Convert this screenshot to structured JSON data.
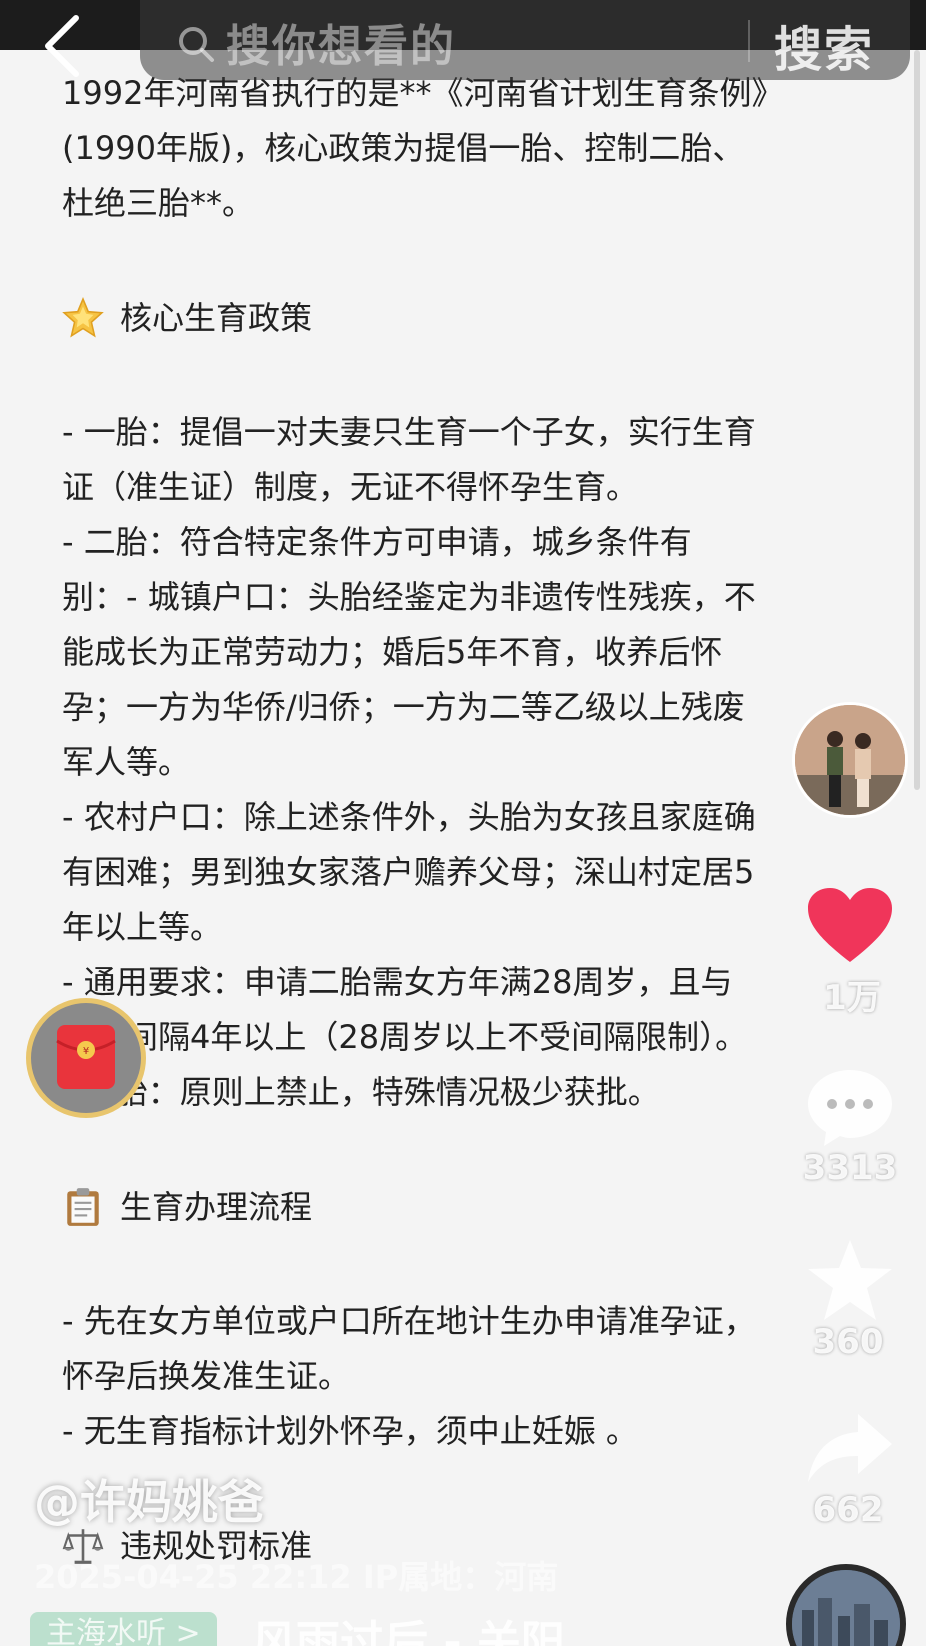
{
  "search": {
    "placeholder": "搜你想看的",
    "button": "搜索"
  },
  "document": {
    "intro": [
      "1992年河南省执行的是**《河南省计划生育条例》",
      "(1990年版)，核心政策为提倡一胎、控制二胎、",
      "杜绝三胎**。"
    ],
    "section1_title": "核心生育政策",
    "section1_lines": [
      "- 一胎：提倡一对夫妻只生育一个子女，实行生育",
      "证（准生证）制度，无证不得怀孕生育。",
      "- 二胎：符合特定条件方可申请，城乡条件有",
      "别：- 城镇户口：头胎经鉴定为非遗传性残疾，不",
      "能成长为正常劳动力；婚后5年不育，收养后怀",
      "孕；一方为华侨/归侨；一方为二等乙级以上残废",
      "军人等。",
      "- 农村户口：除上述条件外，头胎为女孩且家庭确",
      "有困难；男到独女家落户赡养父母；深山村定居5",
      "年以上等。",
      "- 通用要求：申请二胎需女方年满28周岁，且与",
      "头胎间隔4年以上（28周岁以上不受间隔限制）。",
      "- 三胎：原则上禁止，特殊情况极少获批。"
    ],
    "section2_title": "生育办理流程",
    "section2_lines": [
      "- 先在女方单位或户口所在地计生办申请准孕证，",
      "怀孕后换发准生证。",
      "- 无生育指标计划外怀孕，须中止妊娠 。"
    ],
    "section3_title": "违规处罚标准"
  },
  "rail": {
    "likes": "1万",
    "comments": "3313",
    "favorites": "360",
    "shares": "662"
  },
  "overlay": {
    "author": "@许妈姚爸",
    "meta": "2025-04-25 22:12  IP属地：河南",
    "tag": "主海水听 >",
    "song": "风雨过后 - 关阳"
  },
  "icons": [
    "back-icon",
    "search-icon",
    "star-emoji-icon",
    "clipboard-emoji-icon",
    "scales-emoji-icon",
    "heart-icon",
    "comment-icon",
    "favorite-star-icon",
    "share-icon",
    "red-packet-icon"
  ],
  "colors": {
    "like": "#f0355a",
    "redpacket": "#e9343c"
  }
}
